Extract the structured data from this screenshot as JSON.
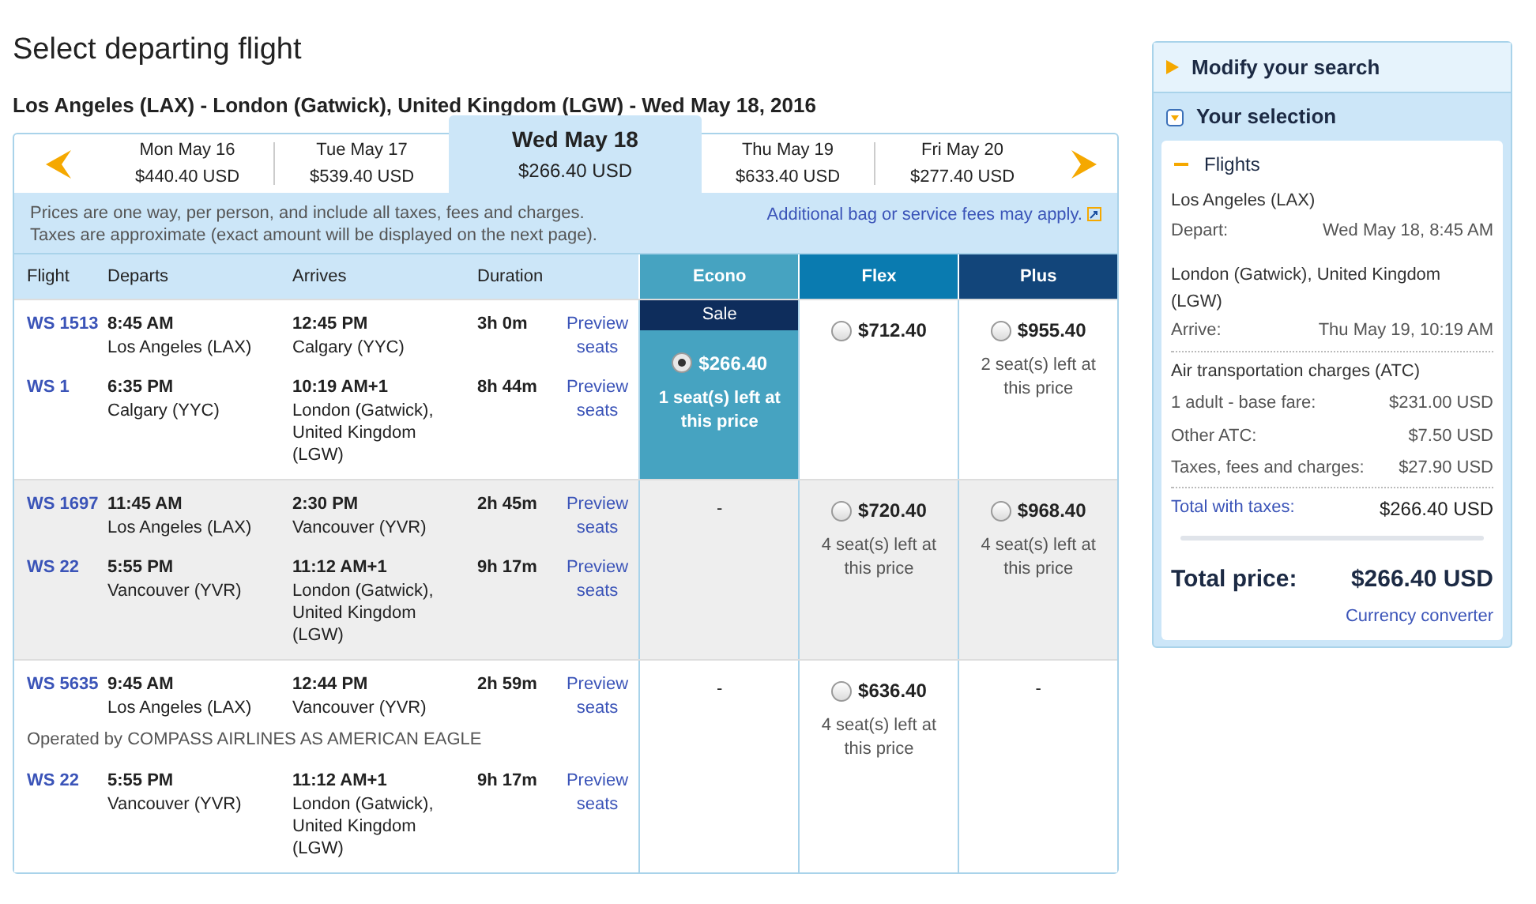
{
  "title": "Select departing flight",
  "route": "Los Angeles (LAX) - London (Gatwick), United Kingdom (LGW) - Wed May 18, 2016",
  "dates": [
    {
      "day": "Mon May 16",
      "price": "$440.40 USD",
      "selected": false
    },
    {
      "day": "Tue May 17",
      "price": "$539.40 USD",
      "selected": false
    },
    {
      "day": "Wed May 18",
      "price": "$266.40 USD",
      "selected": true
    },
    {
      "day": "Thu May 19",
      "price": "$633.40 USD",
      "selected": false
    },
    {
      "day": "Fri May 20",
      "price": "$277.40 USD",
      "selected": false
    }
  ],
  "notice": [
    "Prices are one way, per person, and include all taxes, fees and charges.",
    "Taxes are approximate (exact amount will be displayed on the next page)."
  ],
  "fees_link": "Additional bag or service fees may apply.",
  "columns": [
    "Flight",
    "Departs",
    "Arrives",
    "Duration"
  ],
  "fare_columns": [
    {
      "label": "Econo",
      "color": "#46a3c1"
    },
    {
      "label": "Flex",
      "color": "#0a7bb0"
    },
    {
      "label": "Plus",
      "color": "#12457a"
    }
  ],
  "rows": [
    {
      "shaded": false,
      "segments": [
        {
          "flight": "WS 1513",
          "dep_time": "8:45 AM",
          "dep_place": "Los Angeles (LAX)",
          "arr_time": "12:45 PM",
          "arr_place": "Calgary (YYC)",
          "duration": "3h 0m",
          "preview": "Preview seats"
        },
        {
          "flight": "WS 1",
          "dep_time": "6:35 PM",
          "dep_place": "Calgary (YYC)",
          "arr_time": "10:19 AM+1",
          "arr_place": "London (Gatwick), United Kingdom (LGW)",
          "duration": "8h 44m",
          "preview": "Preview seats"
        }
      ],
      "fares": [
        {
          "kind": "price",
          "badge": "Sale",
          "price": "$266.40",
          "seats": "1 seat(s) left at this price",
          "selected": true
        },
        {
          "kind": "price",
          "price": "$712.40",
          "selected": false
        },
        {
          "kind": "price",
          "price": "$955.40",
          "seats": "2 seat(s) left at this price",
          "selected": false
        }
      ]
    },
    {
      "shaded": true,
      "segments": [
        {
          "flight": "WS 1697",
          "dep_time": "11:45 AM",
          "dep_place": "Los Angeles (LAX)",
          "arr_time": "2:30 PM",
          "arr_place": "Vancouver (YVR)",
          "duration": "2h 45m",
          "preview": "Preview seats"
        },
        {
          "flight": "WS 22",
          "dep_time": "5:55 PM",
          "dep_place": "Vancouver (YVR)",
          "arr_time": "11:12 AM+1",
          "arr_place": "London (Gatwick), United Kingdom (LGW)",
          "duration": "9h 17m",
          "preview": "Preview seats"
        }
      ],
      "fares": [
        {
          "kind": "none",
          "text": "-"
        },
        {
          "kind": "price",
          "price": "$720.40",
          "seats": "4 seat(s) left at this price",
          "selected": false
        },
        {
          "kind": "price",
          "price": "$968.40",
          "seats": "4 seat(s) left at this price",
          "selected": false
        }
      ]
    },
    {
      "shaded": false,
      "segments": [
        {
          "flight": "WS 5635",
          "dep_time": "9:45 AM",
          "dep_place": "Los Angeles (LAX)",
          "arr_time": "12:44 PM",
          "arr_place": "Vancouver (YVR)",
          "duration": "2h 59m",
          "preview": "Preview seats",
          "note": "Operated by COMPASS AIRLINES AS AMERICAN EAGLE"
        },
        {
          "flight": "WS 22",
          "dep_time": "5:55 PM",
          "dep_place": "Vancouver (YVR)",
          "arr_time": "11:12 AM+1",
          "arr_place": "London (Gatwick), United Kingdom (LGW)",
          "duration": "9h 17m",
          "preview": "Preview seats"
        }
      ],
      "fares": [
        {
          "kind": "none",
          "text": "-"
        },
        {
          "kind": "price",
          "price": "$636.40",
          "seats": "4 seat(s) left at this price",
          "selected": false
        },
        {
          "kind": "none",
          "text": "-"
        }
      ]
    }
  ],
  "sidebar": {
    "modify": "Modify your search",
    "selection": "Your selection",
    "flights": "Flights",
    "origin": "Los Angeles (LAX)",
    "depart_label": "Depart:",
    "depart_value": "Wed May 18, 8:45 AM",
    "destination": "London (Gatwick), United Kingdom (LGW)",
    "arrive_label": "Arrive:",
    "arrive_value": "Thu May 19, 10:19 AM",
    "charges_title": "Air transportation charges (ATC)",
    "charges": [
      {
        "label": "1 adult - base fare:",
        "value": "$231.00 USD"
      },
      {
        "label": "Other ATC:",
        "value": "$7.50 USD"
      },
      {
        "label": "Taxes, fees and charges:",
        "value": "$27.90 USD"
      }
    ],
    "total_label": "Total with taxes:",
    "total_value": "$266.40 USD",
    "price_label": "Total price:",
    "price_value": "$266.40 USD",
    "converter": "Currency converter"
  }
}
